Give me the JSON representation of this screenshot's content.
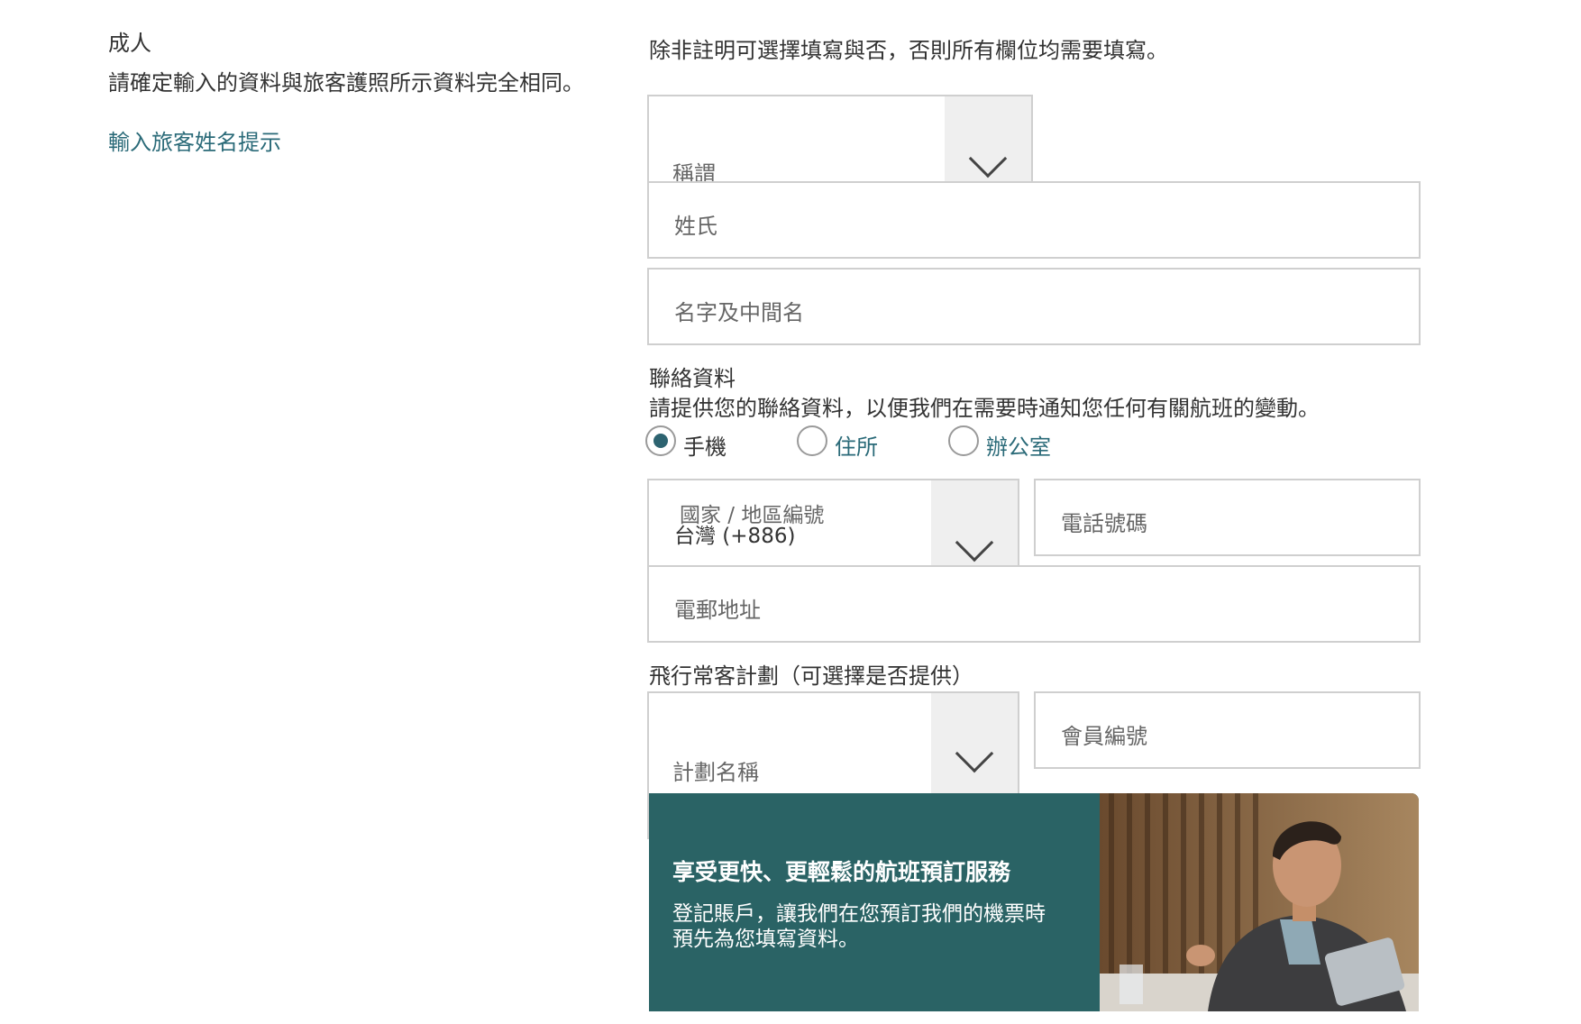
{
  "left_panel": {
    "passenger_type": "成人",
    "instruction": "請確定輸入的資料與旅客護照所示資料完全相同。",
    "name_tips_link": "輸入旅客姓名提示"
  },
  "form": {
    "required_note": "除非註明可選擇填寫與否，否則所有欄位均需要填寫。",
    "title_select": {
      "label": "稱謂",
      "value": ""
    },
    "surname": {
      "placeholder": "姓氏",
      "value": ""
    },
    "given_name": {
      "placeholder": "名字及中間名",
      "value": ""
    }
  },
  "contact": {
    "heading": "聯絡資料",
    "description": "請提供您的聯絡資料，以便我們在需要時通知您任何有關航班的變動。",
    "phone_types": [
      {
        "label": "手機",
        "checked": true
      },
      {
        "label": "住所",
        "checked": false
      },
      {
        "label": "辦公室",
        "checked": false
      }
    ],
    "country_code": {
      "label": "國家 / 地區編號",
      "value": "台灣 (+886)"
    },
    "phone": {
      "placeholder": "電話號碼",
      "value": ""
    },
    "email": {
      "placeholder": "電郵地址",
      "value": ""
    }
  },
  "frequent_flyer": {
    "heading": "飛行常客計劃（可選擇是否提供）",
    "program": {
      "label": "計劃名稱",
      "value": ""
    },
    "member_no": {
      "placeholder": "會員編號",
      "value": ""
    }
  },
  "promo": {
    "title": "享受更快、更輕鬆的航班預訂服務",
    "body_line1": "登記賬戶，讓我們在您預訂我們的機票時",
    "body_line2": "預先為您填寫資料。",
    "bg_color": "#2a6365"
  },
  "colors": {
    "link": "#2a6a78",
    "radio_selected": "#2d6370",
    "select_button": "#efefef",
    "field_border": "#cfcfcf"
  }
}
